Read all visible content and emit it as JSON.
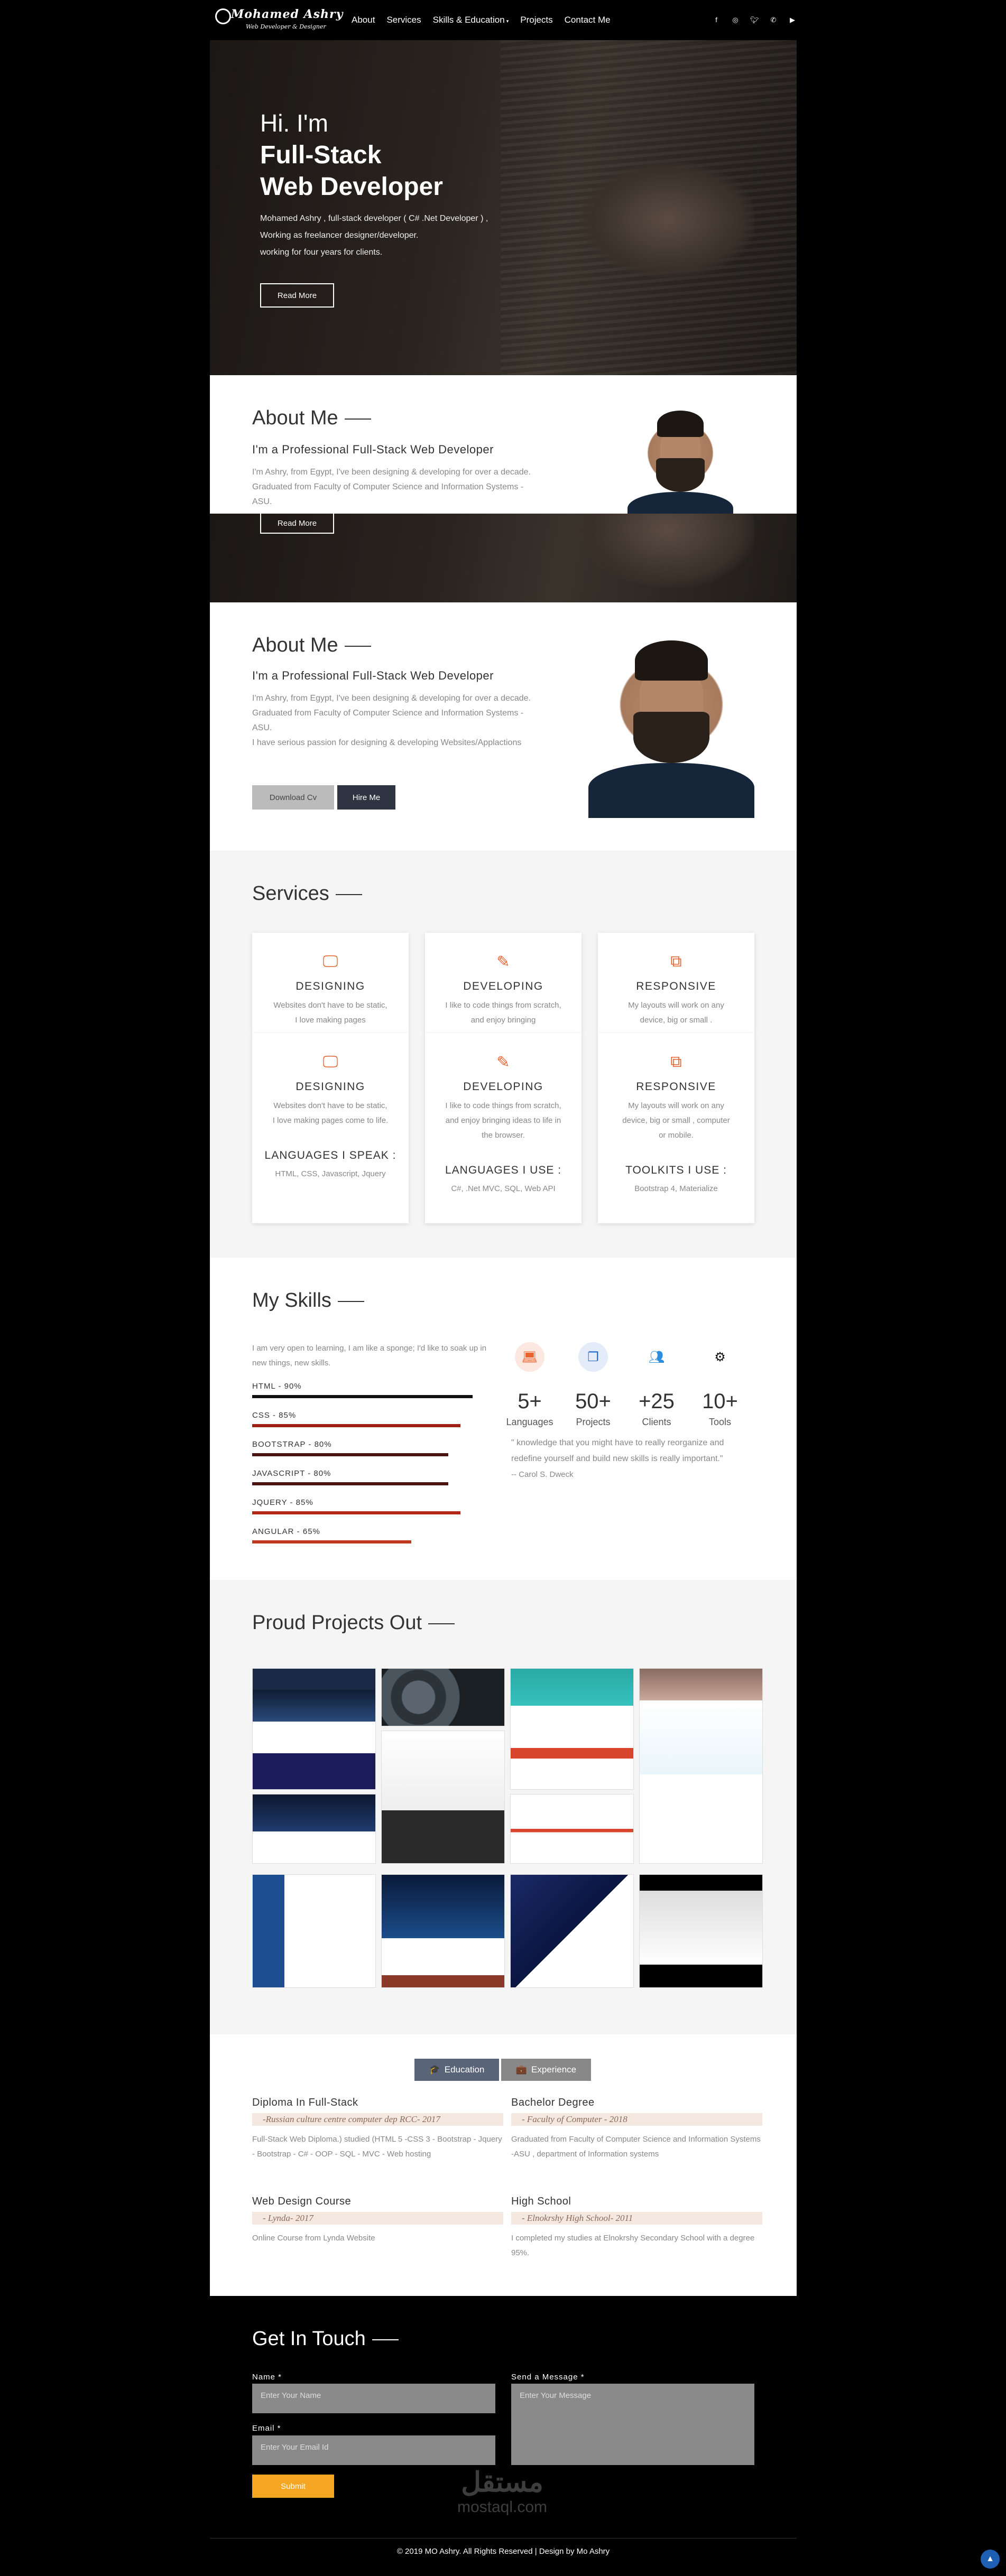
{
  "nav": {
    "logo_title": "Mohamed Ashry",
    "logo_subtitle": "Web Developer & Designer",
    "links": [
      "About",
      "Services",
      "Skills & Education",
      "Projects",
      "Contact Me"
    ],
    "social_icons": [
      "facebook-icon",
      "instagram-icon",
      "twitter-icon",
      "whatsapp-icon",
      "youtube-icon"
    ]
  },
  "hero": {
    "greeting": "Hi. I'm",
    "title_line1": "Full-Stack",
    "title_line2": "Web Developer",
    "desc_line1": "Mohamed Ashry , full-stack developer ( C# .Net Developer ) ,",
    "desc_line2": "Working as freelancer designer/developer.",
    "desc_line3": "working for four years for clients.",
    "button": "Read More"
  },
  "about_preview": {
    "title": "About Me",
    "subtitle": "I'm a Professional Full-Stack Web Developer",
    "text": "I'm Ashry, from Egypt, I've been designing & developing for over a decade. Graduated from Faculty of Computer Science and Information Systems -ASU.",
    "overlay_button": "Read More"
  },
  "about": {
    "title": "About Me",
    "subtitle": "I'm a Professional Full-Stack Web Developer",
    "text1": "I'm Ashry, from Egypt, I've been designing & developing for over a decade. Graduated from Faculty of Computer Science and Information Systems -ASU.",
    "text2": "I have serious passion for designing & developing Websites/Applactions",
    "download_button": "Download Cv",
    "hire_button": "Hire Me"
  },
  "services": {
    "title": "Services",
    "top_row": [
      {
        "icon": "monitor-icon",
        "title": "DESIGNING",
        "desc": "Websites don't have to be static, I love making pages"
      },
      {
        "icon": "edit-icon",
        "title": "DEVELOPING",
        "desc": "I like to code things from scratch, and enjoy bringing"
      },
      {
        "icon": "responsive-icon",
        "title": "RESPONSIVE",
        "desc": "My layouts will work on any device, big or small ."
      }
    ],
    "cards": [
      {
        "icon": "monitor-icon",
        "title": "DESIGNING",
        "desc": "Websites don't have to be static, I love making pages come to life.",
        "heading": "LANGUAGES I SPEAK :",
        "list": "HTML, CSS, Javascript, Jquery"
      },
      {
        "icon": "edit-icon",
        "title": "DEVELOPING",
        "desc": "I like to code things from scratch, and enjoy bringing ideas to life in the browser.",
        "heading": "LANGUAGES I USE :",
        "list": "C#, .Net MVC, SQL, Web API"
      },
      {
        "icon": "responsive-icon",
        "title": "RESPONSIVE",
        "desc": "My layouts will work on any device, big or small , computer or mobile.",
        "heading": "TOOLKITS I USE :",
        "list": "Bootstrap 4, Materialize"
      }
    ]
  },
  "skills": {
    "title": "My Skills",
    "intro": "I am very open to learning, I am like a sponge; I'd like to soak up in new things, new skills.",
    "items": [
      {
        "label": "HTML - 90%",
        "percent": 90,
        "color": "#111111"
      },
      {
        "label": "CSS - 85%",
        "percent": 85,
        "color": "#a01f12"
      },
      {
        "label": "BOOTSTRAP - 80%",
        "percent": 80,
        "color": "#4a1410"
      },
      {
        "label": "JAVASCRIPT - 80%",
        "percent": 80,
        "color": "#4a1410"
      },
      {
        "label": "JQUERY - 85%",
        "percent": 85,
        "color": "#b3261a"
      },
      {
        "label": "ANGULAR - 65%",
        "percent": 65,
        "color": "#c0391f"
      }
    ],
    "stats": [
      {
        "icon": "laptop-icon",
        "number": "5+",
        "label": "Languages",
        "color": "#e8632e",
        "bg": "#fde8e1"
      },
      {
        "icon": "copy-icon",
        "number": "50+",
        "label": "Projects",
        "color": "#1e66c9",
        "bg": "#e3ecf8"
      },
      {
        "icon": "users-icon",
        "number": "+25",
        "label": "Clients",
        "color": "#2d8ee0",
        "bg": "#ffffff"
      },
      {
        "icon": "gears-icon",
        "number": "10+",
        "label": "Tools",
        "color": "#111111",
        "bg": "#ffffff"
      }
    ],
    "quote": "\" knowledge that you might have to really reorganize and redefine yourself and build new skills is really important.\"",
    "quote_author": "-- Carol S. Dweck"
  },
  "projects": {
    "title": "Proud Projects Out"
  },
  "education": {
    "tab_education": "Education",
    "tab_experience": "Experience",
    "items": [
      {
        "title": "Diploma In Full-Stack",
        "sub": "-Russian culture centre computer dep RCC- 2017",
        "desc": "Full-Stack Web Diploma.) studied (HTML 5 -CSS 3 - Bootstrap - Jquery - Bootstrap - C# - OOP - SQL - MVC - Web hosting"
      },
      {
        "title": "Bachelor Degree",
        "sub": "- Faculty of Computer - 2018",
        "desc": "Graduated from Faculty of Computer Science and Information Systems -ASU , department of Information systems"
      },
      {
        "title": "Web Design Course",
        "sub": "- Lynda- 2017",
        "desc": "Online Course from Lynda Website"
      },
      {
        "title": "High School",
        "sub": "- Elnokrshy High School- 2011",
        "desc": "I completed my studies at Elnokrshy Secondary School with a degree 95%."
      }
    ]
  },
  "contact": {
    "title": "Get In Touch",
    "name_label": "Name *",
    "name_placeholder": "Enter Your Name",
    "email_label": "Email *",
    "email_placeholder": "Enter Your Email Id",
    "message_label": "Send a Message *",
    "message_placeholder": "Enter Your Message",
    "submit": "Submit"
  },
  "footer": {
    "copyright": "© 2019 MO Ashry. All Rights Reserved | Design by Mo Ashry",
    "watermark_ar": "مستقل",
    "watermark_en": "mostaql.com"
  }
}
